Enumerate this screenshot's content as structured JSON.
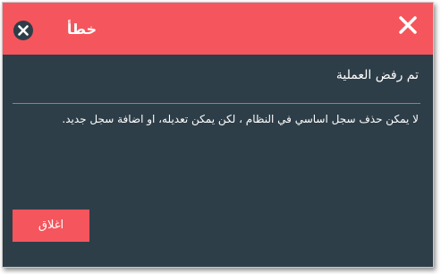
{
  "dialog": {
    "title": "خطأ",
    "close_icon": "close-x-icon",
    "error_icon": "error-circle-icon",
    "subtitle": "تم رفض العملية",
    "message": "لا يمكن حذف سجل اساسي في النظام ، لكن يمكن تعديله، او اضافة سجل جديد.",
    "close_button_label": "اغلاق"
  },
  "colors": {
    "header": "#f5555c",
    "body": "#2d3e48",
    "divider": "#e8595e",
    "button": "#f5555c",
    "text": "#ffffff",
    "icon_dark": "#2d3e48"
  }
}
